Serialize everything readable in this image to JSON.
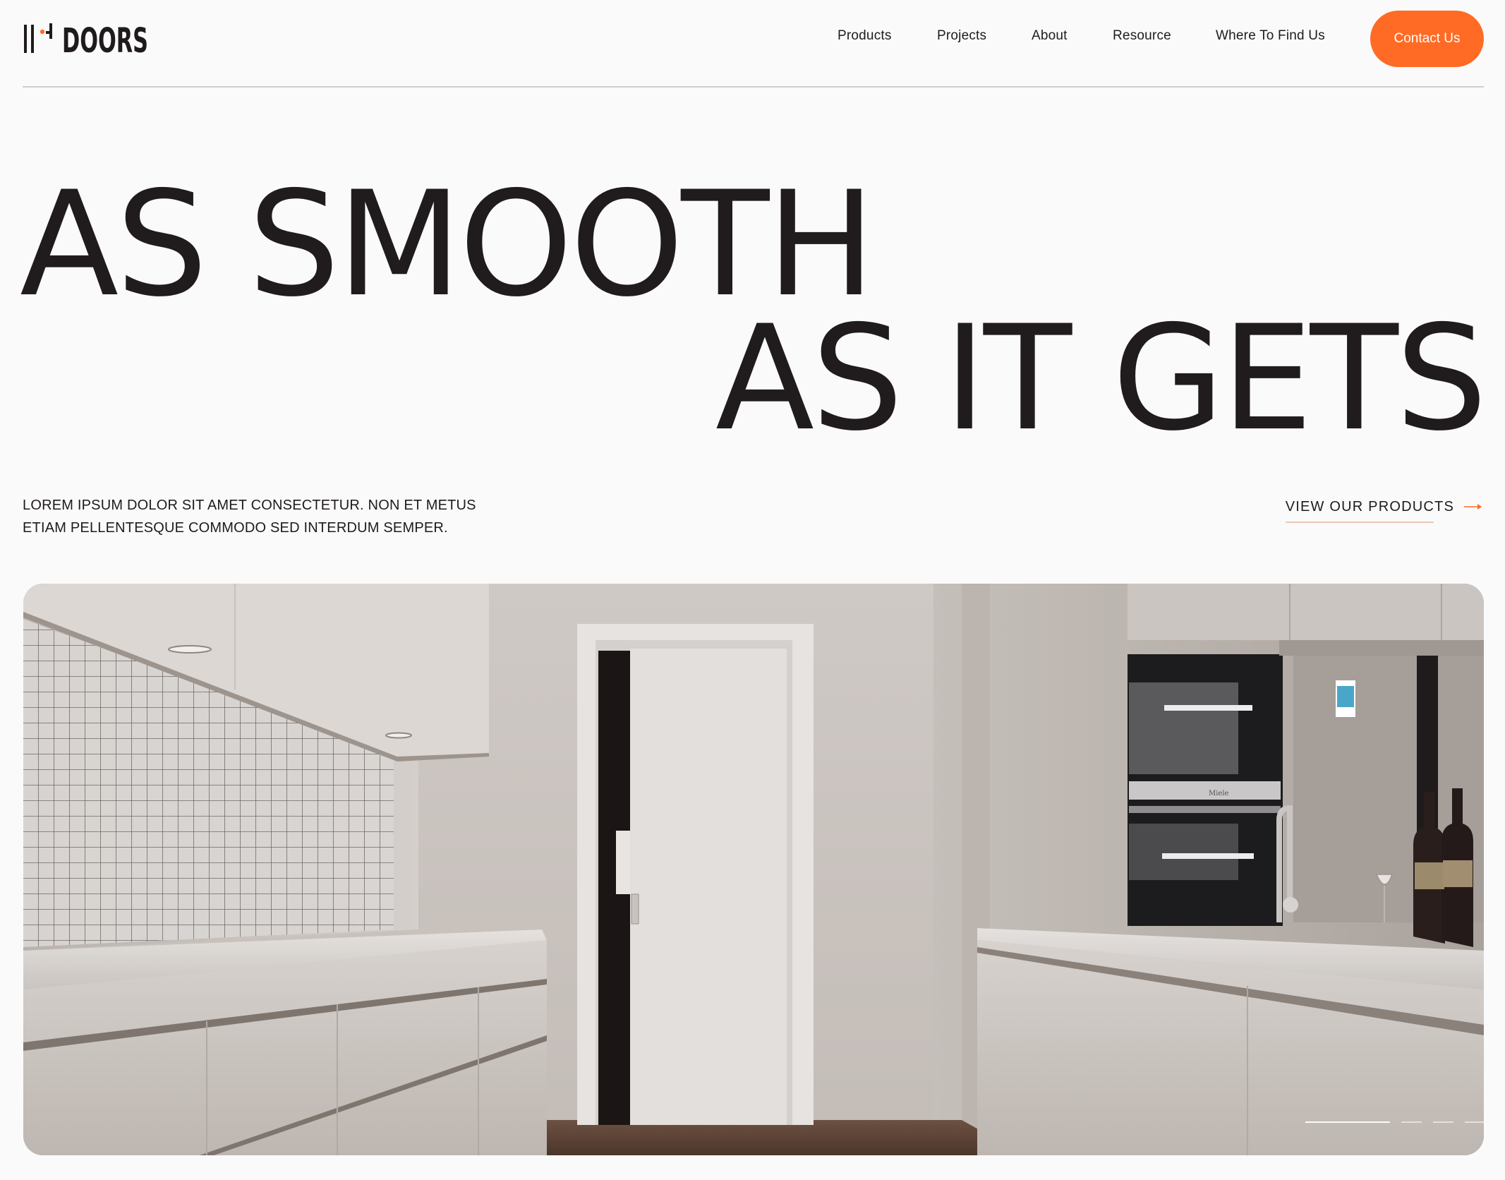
{
  "brand": {
    "name": "DOORS",
    "accent": "#ff6b24"
  },
  "nav": {
    "items": [
      {
        "label": "Products"
      },
      {
        "label": "Projects"
      },
      {
        "label": "About"
      },
      {
        "label": "Resource"
      },
      {
        "label": "Where To Find  Us"
      }
    ],
    "contact_label": "Contact Us"
  },
  "hero": {
    "line1": "AS SMOOTH",
    "line2": "AS IT GETS",
    "intro_line1": "LOREM IPSUM DOLOR SIT AMET CONSECTETUR. NON ET METUS",
    "intro_line2": "ETIAM PELLENTESQUE COMMODO SED INTERDUM SEMPER.",
    "cta_label": "VIEW OUR PRODUCTS",
    "cta_icon": "arrow-right-icon"
  },
  "image": {
    "subject": "kitchen-with-sliding-door-photo",
    "oven_brand": "Miele"
  },
  "slider": {
    "count": 4,
    "active_index": 1
  }
}
